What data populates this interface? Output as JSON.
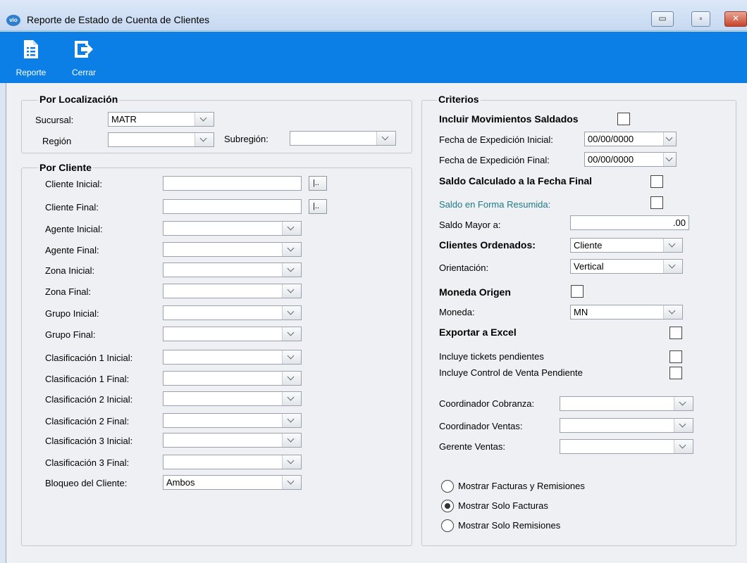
{
  "window": {
    "title": "Reporte de Estado de Cuenta de Clientes",
    "icon_text": "vio",
    "controls": {
      "minimize": "▭",
      "maximize": "▫",
      "close": "✕"
    }
  },
  "toolbar": {
    "buttons": [
      {
        "label": "Reporte",
        "icon": "report-icon"
      },
      {
        "label": "Cerrar",
        "icon": "exit-icon"
      }
    ]
  },
  "localizacion": {
    "title": "Por Localización",
    "sucursal_label": "Sucursal:",
    "sucursal_value": "MATR",
    "region_label": "Región",
    "region_value": "",
    "subregion_label": "Subregión:",
    "subregion_value": ""
  },
  "cliente": {
    "title": "Por Cliente",
    "lookup_label": "|..",
    "rows": [
      {
        "label": "Cliente Inicial:",
        "value": "",
        "kind": "lookup"
      },
      {
        "label": "Cliente Final:",
        "value": "",
        "kind": "lookup"
      },
      {
        "label": "Agente Inicial:",
        "value": "",
        "kind": "combo"
      },
      {
        "label": "Agente Final:",
        "value": "",
        "kind": "combo"
      },
      {
        "label": "Zona Inicial:",
        "value": "",
        "kind": "combo"
      },
      {
        "label": "Zona Final:",
        "value": "",
        "kind": "combo"
      },
      {
        "label": "Grupo Inicial:",
        "value": "",
        "kind": "combo"
      },
      {
        "label": "Grupo Final:",
        "value": "",
        "kind": "combo"
      },
      {
        "label": "Clasificación 1 Inicial:",
        "value": "",
        "kind": "combo"
      },
      {
        "label": "Clasificación 1 Final:",
        "value": "",
        "kind": "combo"
      },
      {
        "label": "Clasificación 2 Inicial:",
        "value": "",
        "kind": "combo"
      },
      {
        "label": "Clasificación 2 Final:",
        "value": "",
        "kind": "combo"
      },
      {
        "label": "Clasificación 3 Inicial:",
        "value": "",
        "kind": "combo"
      },
      {
        "label": "Clasificación 3 Final:",
        "value": "",
        "kind": "combo"
      },
      {
        "label": "Bloqueo del Cliente:",
        "value": "Ambos",
        "kind": "combo"
      }
    ]
  },
  "criterios": {
    "title": "Criterios",
    "incluir_mov_saldados": {
      "label": "Incluir Movimientos Saldados",
      "checked": false
    },
    "fecha_inicial": {
      "label": "Fecha de Expedición Inicial:",
      "value": "00/00/0000"
    },
    "fecha_final": {
      "label": "Fecha de Expedición Final:",
      "value": "00/00/0000"
    },
    "saldo_calculado": {
      "label": "Saldo Calculado a la Fecha Final",
      "checked": false
    },
    "saldo_resumida": {
      "label": "Saldo en Forma Resumida:",
      "checked": false
    },
    "saldo_mayor": {
      "label": "Saldo Mayor a:",
      "value": ".00"
    },
    "clientes_ordenados": {
      "label": "Clientes Ordenados:",
      "value": "Cliente"
    },
    "orientacion": {
      "label": "Orientación:",
      "value": "Vertical"
    },
    "moneda_origen": {
      "label": "Moneda Origen",
      "checked": false
    },
    "moneda": {
      "label": "Moneda:",
      "value": "MN"
    },
    "exportar_excel": {
      "label": "Exportar a Excel",
      "checked": false
    },
    "tickets_pendientes": {
      "label": "Incluye tickets pendientes",
      "checked": false
    },
    "control_venta": {
      "label": "Incluye Control de Venta Pendiente",
      "checked": false
    },
    "coord_cobranza": {
      "label": "Coordinador Cobranza:",
      "value": ""
    },
    "coord_ventas": {
      "label": "Coordinador Ventas:",
      "value": ""
    },
    "gerente_ventas": {
      "label": "Gerente Ventas:",
      "value": ""
    },
    "mostrar": {
      "selected": 1,
      "options": [
        "Mostrar Facturas y Remisiones",
        "Mostrar Solo Facturas",
        "Mostrar Solo Remisiones"
      ]
    }
  }
}
